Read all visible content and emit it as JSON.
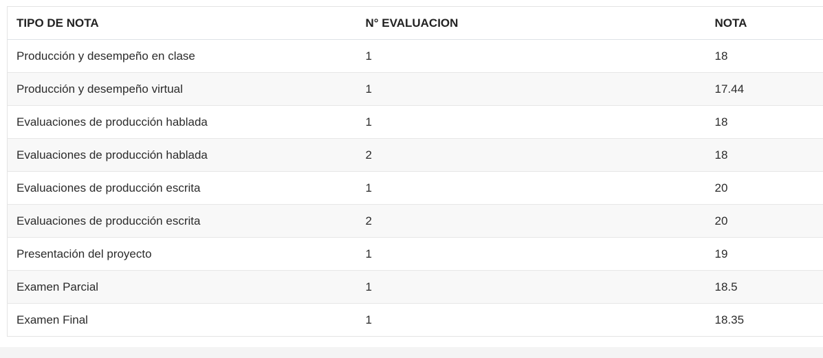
{
  "table": {
    "headers": [
      "TIPO DE NOTA",
      "N° EVALUACION",
      "NOTA"
    ],
    "rows": [
      [
        "Producción y desempeño en clase",
        "1",
        "18"
      ],
      [
        "Producción y desempeño virtual",
        "1",
        "17.44"
      ],
      [
        "Evaluaciones de producción hablada",
        "1",
        "18"
      ],
      [
        "Evaluaciones de producción hablada",
        "2",
        "18"
      ],
      [
        "Evaluaciones de producción escrita",
        "1",
        "20"
      ],
      [
        "Evaluaciones de producción escrita",
        "2",
        "20"
      ],
      [
        "Presentación del proyecto",
        "1",
        "19"
      ],
      [
        "Examen Parcial",
        "1",
        "18.5"
      ],
      [
        "Examen Final",
        "1",
        "18.35"
      ]
    ]
  }
}
